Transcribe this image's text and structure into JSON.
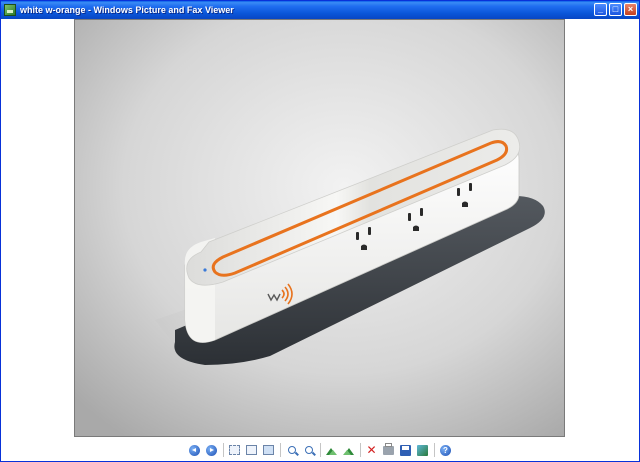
{
  "window": {
    "title": "white w-orange - Windows Picture and Fax Viewer",
    "icon": "picture-viewer-icon",
    "buttons": [
      "minimize-icon",
      "maximize-icon",
      "close-icon"
    ]
  },
  "image": {
    "subject": "power-strip-render",
    "accent_color": "#e8731e",
    "body_color": "#f4f4f2",
    "base_color": "#3a3f45"
  },
  "toolbar": {
    "icons": [
      "previous-image-icon",
      "next-image-icon",
      "best-fit-icon",
      "actual-size-icon",
      "slideshow-icon",
      "zoom-in-icon",
      "zoom-out-icon",
      "rotate-clockwise-icon",
      "rotate-counterclockwise-icon",
      "delete-icon",
      "print-icon",
      "copy-to-icon",
      "edit-icon",
      "help-icon"
    ]
  }
}
